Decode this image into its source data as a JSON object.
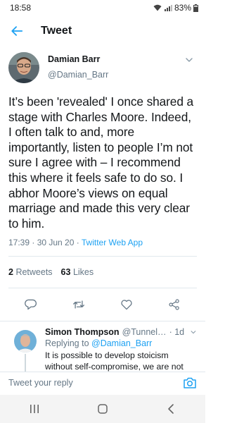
{
  "status_bar": {
    "time": "18:58",
    "battery": "83%"
  },
  "header": {
    "title": "Tweet"
  },
  "tweet": {
    "author_name": "Damian Barr",
    "author_handle": "@Damian_Barr",
    "text": "It’s been 'revealed' I once shared a stage with Charles Moore. Indeed, I often talk to and, more importantly, listen to people I’m not sure I agree with – I recommend this where it feels safe to do so. I abhor Moore’s views on equal marriage and made this very clear to him.",
    "timestamp": "17:39 · 30 Jun 20 · ",
    "source": "Twitter Web App",
    "retweets_count": "2",
    "retweets_label": "Retweets",
    "likes_count": "63",
    "likes_label": "Likes"
  },
  "reply": {
    "name": "Simon Thompson",
    "handle": "@Tunnelbre...",
    "time": "· 1d",
    "replying_prefix": "Replying to ",
    "replying_to": "@Damian_Barr",
    "text": "It is possible to develop stoicism without self-compromise, we are not put on this earth to throw stones at every dog that"
  },
  "compose": {
    "placeholder": "Tweet your reply"
  },
  "colors": {
    "accent": "#1da1f2",
    "text": "#14171a",
    "secondary": "#657786"
  },
  "icons": [
    "wifi-icon",
    "signal-icon",
    "battery-icon",
    "back-arrow-icon",
    "chevron-down-icon",
    "reply-icon",
    "retweet-icon",
    "like-icon",
    "share-icon",
    "camera-icon",
    "recent-apps-icon",
    "home-icon",
    "back-icon"
  ]
}
